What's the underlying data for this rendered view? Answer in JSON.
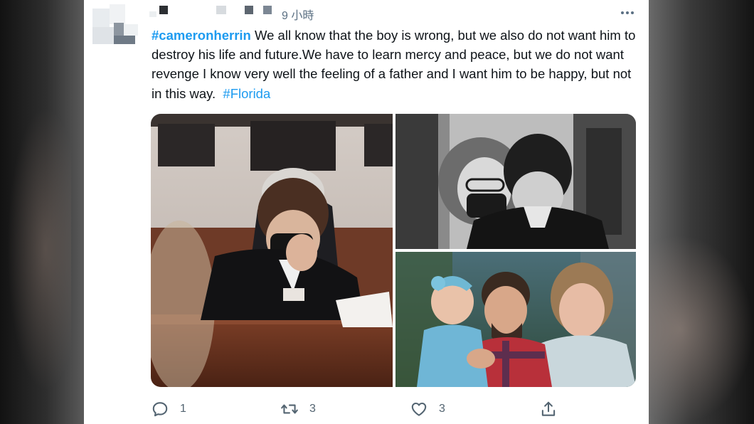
{
  "tweet": {
    "timestamp": "9 小時",
    "text_parts": {
      "hashtag1": "#cameronherrin",
      "body": " We all know that the boy is wrong, but we also do not want him to destroy his life and future.We have to learn mercy and peace, but we do not want revenge I know very well the feeling of a father and I want him to be happy, but not in this way.  ",
      "hashtag2": "#Florida"
    },
    "icons": {
      "more": "more-horizontal-icon",
      "reply": "reply-icon",
      "retweet": "retweet-icon",
      "like": "heart-icon",
      "share": "share-icon"
    },
    "actions": {
      "reply_count": "1",
      "retweet_count": "3",
      "like_count": "3"
    },
    "colors": {
      "link": "#1d9bf0",
      "text": "#0f1419",
      "muted": "#536471"
    }
  }
}
